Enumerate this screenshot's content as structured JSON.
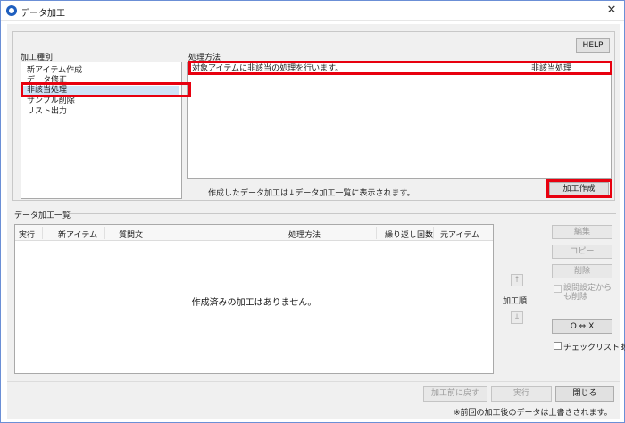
{
  "window": {
    "title": "データ加工",
    "close_glyph": "✕"
  },
  "help_button": "HELP",
  "processing_types": {
    "label": "加工種別",
    "items": [
      "新アイテム作成",
      "データ修正",
      "非該当処理",
      "サンプル削除",
      "リスト出力"
    ],
    "selected": "非該当処理"
  },
  "processing_method": {
    "label": "処理方法",
    "rows": [
      {
        "description": "対象アイテムに非該当の処理を行います。",
        "name": "非該当処理"
      }
    ]
  },
  "create_note": "作成したデータ加工は↓データ加工一覧に表示されます。",
  "create_button": "加工作成",
  "list": {
    "label": "データ加工一覧",
    "columns": [
      "実行",
      "新アイテム",
      "質問文",
      "処理方法",
      "繰り返し回数",
      "元アイテム"
    ],
    "empty_message": "作成済みの加工はありません。"
  },
  "side_buttons": {
    "edit": "編集",
    "copy": "コピー",
    "delete": "削除",
    "also_delete_setting": "設問設定からも削除",
    "order_label": "加工順",
    "up_glyph": "↑",
    "down_glyph": "↓",
    "toggle": "O ⇔ X",
    "checklist": "チェックリストあり"
  },
  "footer": {
    "revert": "加工前に戻す",
    "execute": "実行",
    "close": "閉じる",
    "note": "※前回の加工後のデータは上書きされます。"
  },
  "colors": {
    "highlight": "#e8000f",
    "selection": "#cfe3f7",
    "accent": "#1f5fbf"
  }
}
